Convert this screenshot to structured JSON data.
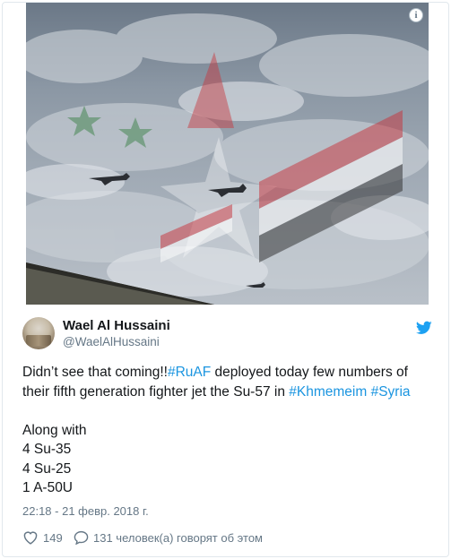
{
  "tweet": {
    "author_name": "Wael Al Hussaini",
    "author_handle": "@WaelAlHussaini",
    "text_part1": "Didn’t see that coming!!",
    "hashtag_ruaf": "#RuAF",
    "text_part2": " deployed today few numbers of their fifth generation fighter jet the Su-57 in ",
    "hashtag_khmemeim": "#Khmemeim",
    "text_space": " ",
    "hashtag_syria": "#Syria",
    "text_part3": "\n\nAlong with\n4 Su-35\n4 Su-25\n1 A-50U",
    "timestamp": "22:18 - 21 февр. 2018 г.",
    "likes_count": "149",
    "replies_text": "131 человек(а) говорят об этом"
  },
  "media": {
    "info_label": "i",
    "description_icon": "aircraft-photo"
  },
  "colors": {
    "link": "#1b95e0",
    "text": "#14171a",
    "muted": "#657786",
    "twitter_blue": "#1da1f2",
    "border": "#e1e8ed"
  }
}
